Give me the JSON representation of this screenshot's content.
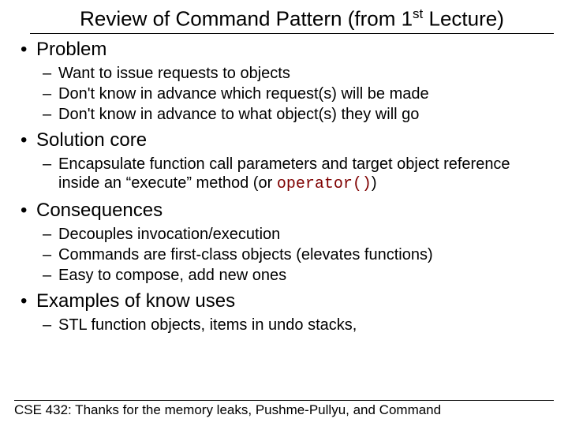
{
  "title_pre": "Review of Command Pattern (from 1",
  "title_sup": "st",
  "title_post": " Lecture)",
  "sections": {
    "problem": {
      "heading": "Problem",
      "items": [
        "Want to issue requests to objects",
        "Don't know in advance which request(s) will be made",
        "Don't know in advance to what object(s) they will go"
      ]
    },
    "solution": {
      "heading": "Solution core",
      "item_pre": "Encapsulate function call parameters and target object reference inside an “execute” method (or ",
      "item_code": "operator()",
      "item_post": ")"
    },
    "consequences": {
      "heading": "Consequences",
      "items": [
        "Decouples invocation/execution",
        "Commands are first-class objects (elevates functions)",
        "Easy to compose, add new ones"
      ]
    },
    "examples": {
      "heading": "Examples of know uses",
      "items": [
        "STL function objects, items in undo stacks,"
      ]
    }
  },
  "footer": "CSE 432: Thanks for the memory leaks, Pushme-Pullyu, and Command"
}
